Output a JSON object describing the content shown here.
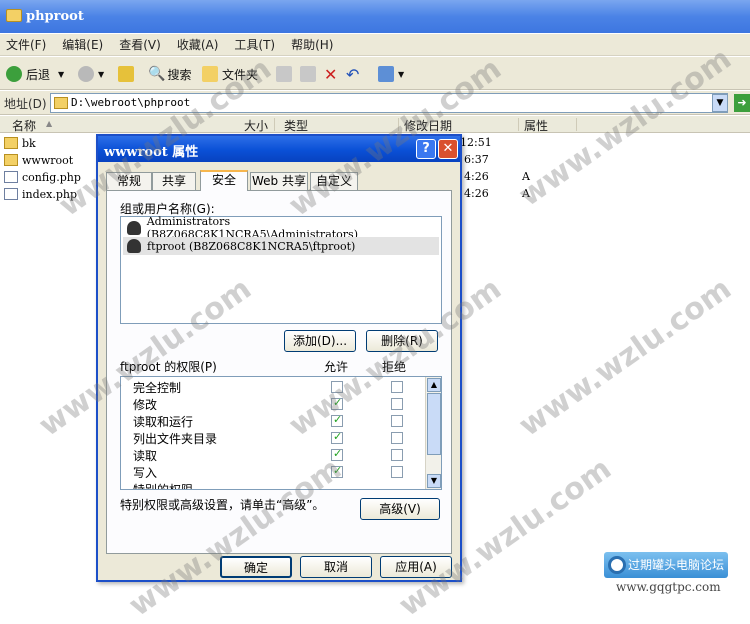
{
  "window": {
    "title": "phproot"
  },
  "menu": [
    "文件(F)",
    "编辑(E)",
    "查看(V)",
    "收藏(A)",
    "工具(T)",
    "帮助(H)"
  ],
  "toolbar": {
    "back": "后退",
    "search": "搜索",
    "folders": "文件夹"
  },
  "address": {
    "label": "地址(D)",
    "value": "D:\\webroot\\phproot"
  },
  "columns": {
    "name": "名称",
    "size": "大小",
    "type": "类型",
    "modified": "修改日期",
    "attrs": "属性"
  },
  "files": [
    {
      "name": "bk",
      "kind": "folder",
      "modified": "12:51",
      "attr": ""
    },
    {
      "name": "wwwroot",
      "kind": "folder",
      "modified": "6:37",
      "attr": ""
    },
    {
      "name": "config.php",
      "kind": "doc",
      "modified": "4:26",
      "attr": "A"
    },
    {
      "name": "index.php",
      "kind": "doc",
      "modified": "4:26",
      "attr": "A"
    }
  ],
  "dialog": {
    "title": "wwwroot 属性",
    "help": "?",
    "close": "✕",
    "tabs": [
      "常规",
      "共享",
      "安全",
      "Web 共享",
      "自定义"
    ],
    "active_tab": "安全",
    "users_label": "组或用户名称(G):",
    "users": [
      "Administrators (B8Z068C8K1NCRA5\\Administrators)",
      "ftproot (B8Z068C8K1NCRA5\\ftproot)"
    ],
    "add_button": "添加(D)...",
    "remove_button": "删除(R)",
    "perm_label": "ftproot 的权限(P)",
    "allow_label": "允许",
    "deny_label": "拒绝",
    "permissions": [
      {
        "name": "完全控制",
        "allow": false,
        "deny": false
      },
      {
        "name": "修改",
        "allow": true,
        "deny": false
      },
      {
        "name": "读取和运行",
        "allow": true,
        "deny": false
      },
      {
        "name": "列出文件夹目录",
        "allow": true,
        "deny": false
      },
      {
        "name": "读取",
        "allow": true,
        "deny": false
      },
      {
        "name": "写入",
        "allow": true,
        "deny": false
      },
      {
        "name": "特别的权限",
        "allow": false,
        "deny": false
      }
    ],
    "advanced_text": "特别权限或高级设置，请单击“高级”。",
    "advanced_button": "高级(V)",
    "ok": "确定",
    "cancel": "取消",
    "apply": "应用(A)"
  },
  "watermark": {
    "text": "www.wzlu.com",
    "logo": "过期罐头电脑论坛",
    "logo_url": "www.gqgtpc.com"
  }
}
